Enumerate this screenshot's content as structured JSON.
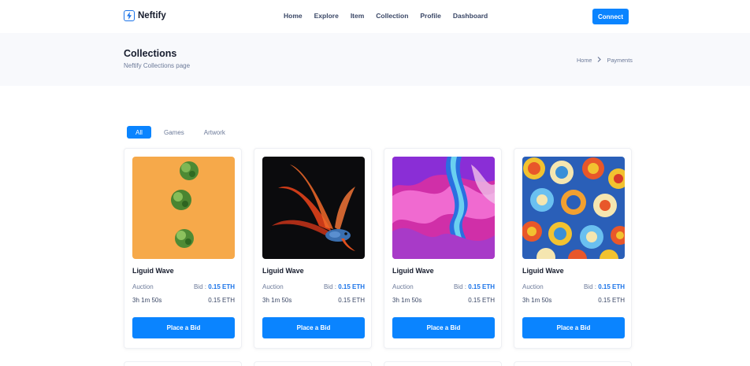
{
  "brand": {
    "name": "Neftify",
    "accent": "#0a84ff"
  },
  "nav": {
    "items": [
      "Home",
      "Explore",
      "Item",
      "Collection",
      "Profile",
      "Dashboard"
    ],
    "connect_label": "Connect"
  },
  "page": {
    "title": "Collections",
    "subtitle": "Neftify Collections page"
  },
  "breadcrumb": {
    "home": "Home",
    "current": "Payments"
  },
  "tabs": [
    "All",
    "Games",
    "Artwork"
  ],
  "cards": [
    {
      "name": "Liguid Wave",
      "image": "sprouts-on-orange",
      "label_auction": "Auction",
      "bid_label": "Bid :",
      "bid_value": "0.15 ETH",
      "time_left": "3h 1m 50s",
      "price": "0.15 ETH",
      "button": "Place a Bid"
    },
    {
      "name": "Liguid Wave",
      "image": "betta-fish",
      "label_auction": "Auction",
      "bid_label": "Bid :",
      "bid_value": "0.15 ETH",
      "time_left": "3h 1m 50s",
      "price": "0.15 ETH",
      "button": "Place a Bid"
    },
    {
      "name": "Liguid Wave",
      "image": "pink-fluid-art",
      "label_auction": "Auction",
      "bid_label": "Bid :",
      "bid_value": "0.15 ETH",
      "time_left": "3h 1m 50s",
      "price": "0.15 ETH",
      "button": "Place a Bid"
    },
    {
      "name": "Liguid Wave",
      "image": "colorful-abstract",
      "label_auction": "Auction",
      "bid_label": "Bid :",
      "bid_value": "0.15 ETH",
      "time_left": "3h 1m 50s",
      "price": "0.15 ETH",
      "button": "Place a Bid"
    }
  ]
}
